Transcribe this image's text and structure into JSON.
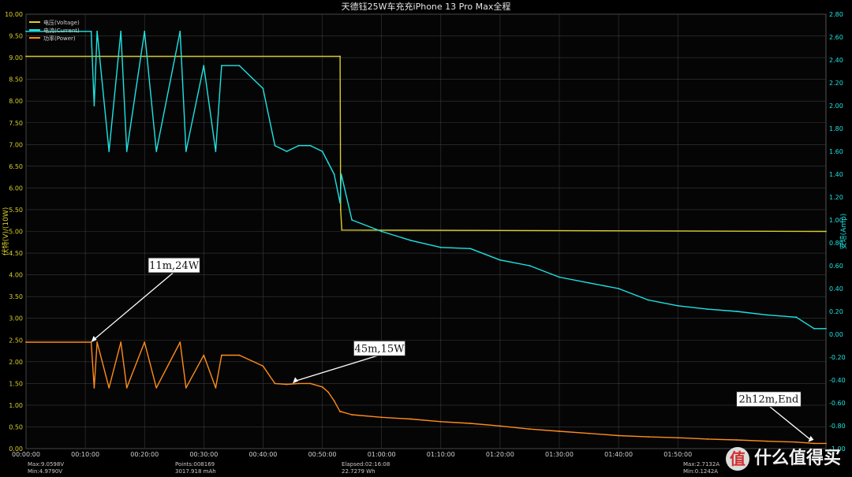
{
  "chart_data": {
    "type": "line",
    "title": "天德钰25W车充充iPhone 13 Pro Max全程",
    "y_left_label": "伏特(V)/(10W)",
    "y_right_label": "安培(Amp)",
    "x_ticks": [
      "00:00:00",
      "00:10:00",
      "00:20:00",
      "00:30:00",
      "00:40:00",
      "00:50:00",
      "01:00:00",
      "01:10:00",
      "01:20:00",
      "01:30:00",
      "01:40:00",
      "01:50:00"
    ],
    "y_left_ticks": [
      "10.00",
      "9.50",
      "9.00",
      "8.50",
      "8.00",
      "7.50",
      "7.00",
      "6.50",
      "6.00",
      "5.50",
      "5.00",
      "4.50",
      "4.00",
      "3.50",
      "3.00",
      "2.50",
      "2.00",
      "1.50",
      "1.00",
      "0.50",
      "0.00"
    ],
    "y_right_ticks": [
      "2.80",
      "2.60",
      "2.40",
      "2.20",
      "2.00",
      "1.80",
      "1.60",
      "1.40",
      "1.20",
      "1.00",
      "0.80",
      "0.60",
      "0.40",
      "0.20",
      "0.00",
      "-0.20",
      "-0.40",
      "-0.60",
      "-0.80",
      "-1.00"
    ],
    "x_range_min": [
      0,
      135
    ],
    "y_left_range": [
      0,
      10
    ],
    "y_right_range": [
      -1.0,
      2.8
    ],
    "series": [
      {
        "name": "电压(Voltage)",
        "axis": "left",
        "color": "#d9cf2a",
        "x": [
          0,
          53,
          53.1,
          53.3,
          135
        ],
        "y": [
          9.03,
          9.03,
          5.5,
          5.03,
          5.0
        ]
      },
      {
        "name": "电流(Current)",
        "axis": "right",
        "color": "#1ee3e3",
        "x": [
          0,
          11,
          11.5,
          12,
          14,
          16,
          17,
          20,
          22,
          26,
          27,
          30,
          32,
          33,
          36,
          40,
          42,
          44,
          46,
          48,
          50,
          51,
          52,
          53,
          53.2,
          55,
          60,
          65,
          70,
          75,
          80,
          85,
          90,
          95,
          100,
          105,
          110,
          115,
          120,
          125,
          130,
          133,
          135
        ],
        "y": [
          2.65,
          2.65,
          2.0,
          2.65,
          1.6,
          2.65,
          1.6,
          2.65,
          1.6,
          2.65,
          1.6,
          2.35,
          1.6,
          2.35,
          2.35,
          2.15,
          1.65,
          1.6,
          1.65,
          1.65,
          1.6,
          1.5,
          1.4,
          1.15,
          1.4,
          1.0,
          0.9,
          0.82,
          0.76,
          0.75,
          0.65,
          0.6,
          0.5,
          0.45,
          0.4,
          0.3,
          0.25,
          0.22,
          0.2,
          0.17,
          0.15,
          0.05,
          0.05
        ]
      },
      {
        "name": "功率(Power)",
        "axis": "left",
        "color": "#ff8c1a",
        "x": [
          0,
          11,
          11.5,
          12,
          14,
          16,
          17,
          20,
          22,
          26,
          27,
          30,
          32,
          33,
          36,
          40,
          42,
          44,
          46,
          48,
          50,
          51,
          52,
          53,
          53.2,
          55,
          60,
          65,
          70,
          75,
          80,
          85,
          90,
          95,
          100,
          105,
          110,
          115,
          120,
          125,
          130,
          133,
          135
        ],
        "y": [
          2.45,
          2.45,
          1.4,
          2.45,
          1.4,
          2.45,
          1.4,
          2.45,
          1.4,
          2.45,
          1.4,
          2.15,
          1.4,
          2.15,
          2.15,
          1.9,
          1.5,
          1.48,
          1.5,
          1.5,
          1.42,
          1.3,
          1.1,
          0.85,
          0.85,
          0.78,
          0.72,
          0.68,
          0.62,
          0.58,
          0.52,
          0.45,
          0.4,
          0.35,
          0.3,
          0.27,
          0.25,
          0.22,
          0.2,
          0.17,
          0.15,
          0.12,
          0.12
        ]
      }
    ],
    "annotations": [
      {
        "text": "11m,24W",
        "x": 11,
        "y": 2.45
      },
      {
        "text": "45m,15W",
        "x": 45,
        "y": 1.5
      },
      {
        "text": "2h12m,End",
        "x": 132,
        "y": 0.15
      }
    ],
    "legend_position": "top-left",
    "grid": true
  },
  "footer": {
    "max_v": "Max:9.0598V",
    "min_v": "Min:4.9790V",
    "points": "Points:008169",
    "mah": "3017.918 mAh",
    "elapsed": "Elapsed:02:16:08",
    "wh": "22.7279 Wh",
    "max_a": "Max:2.7132A",
    "min_a": "Min:0.1242A"
  },
  "watermark": {
    "badge": "值",
    "text": "什么值得买"
  },
  "colors": {
    "background": "#000000",
    "grid": "#3a3a3a",
    "voltage": "#d9cf2a",
    "current": "#1ee3e3",
    "power": "#ff8c1a",
    "annotation_bg": "#ffffff"
  }
}
